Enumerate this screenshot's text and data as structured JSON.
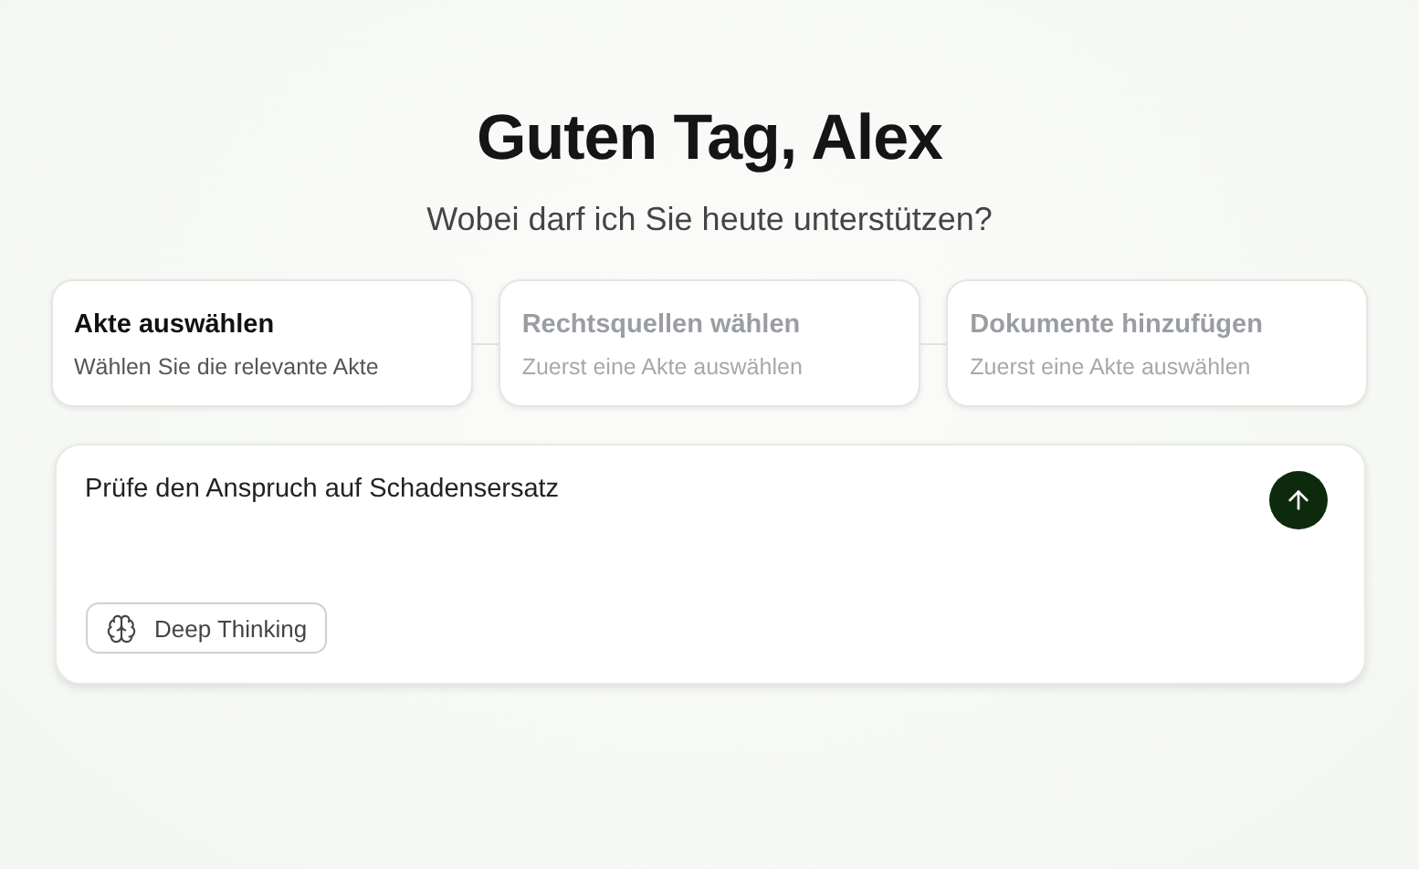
{
  "greeting": "Guten Tag, Alex",
  "subtitle": "Wobei darf ich Sie heute unterstützen?",
  "steps": [
    {
      "title": "Akte auswählen",
      "hint": "Wählen Sie die relevante Akte",
      "disabled": false
    },
    {
      "title": "Rechtsquellen wählen",
      "hint": "Zuerst eine Akte auswählen",
      "disabled": true
    },
    {
      "title": "Dokumente hinzufügen",
      "hint": "Zuerst eine Akte auswählen",
      "disabled": true
    }
  ],
  "composer": {
    "value": "Prüfe den Anspruch auf Schadensersatz",
    "deep_thinking": {
      "label": "Deep Thinking",
      "on": false
    }
  }
}
